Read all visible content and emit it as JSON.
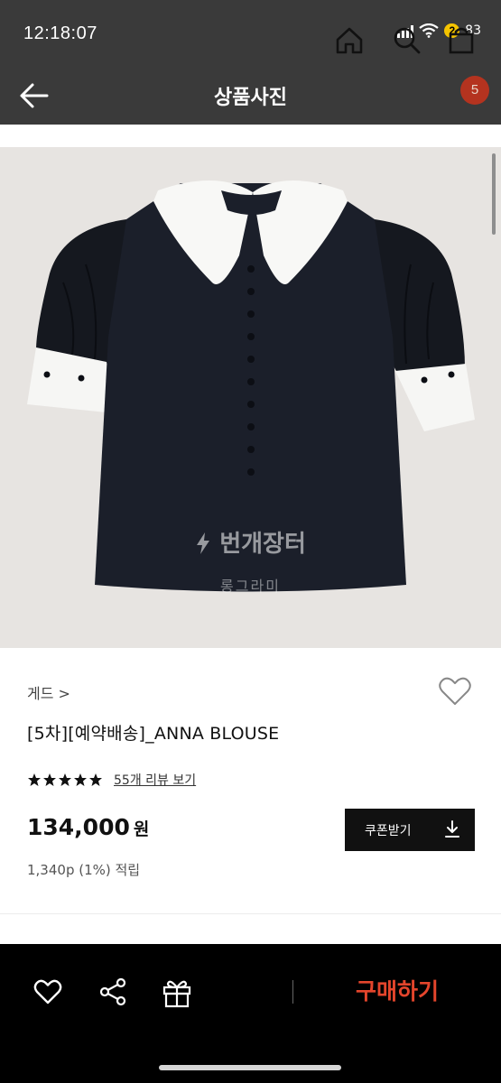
{
  "status_bar": {
    "time": "12:18:07",
    "battery_level": "2",
    "extra": "83"
  },
  "header": {
    "title": "상품사진",
    "cart_count": "5"
  },
  "photo": {
    "watermark_brand": "번개장터",
    "watermark_user": "롱그라미"
  },
  "product": {
    "brand": "게드 >",
    "name": "[5차][예약배송]_ANNA BLOUSE",
    "stars": 5,
    "review_link": "55개 리뷰 보기",
    "price": "134,000",
    "price_unit": "원",
    "points": "1,340p (1%) 적립",
    "coupon_label": "쿠폰받기"
  },
  "bottom_bar": {
    "buy_label": "구매하기"
  },
  "colors": {
    "header_bg": "#3a3a3a",
    "cart_badge": "#b4331f",
    "buy_text": "#e4452c",
    "photo_bg": "#e7e4e1"
  }
}
